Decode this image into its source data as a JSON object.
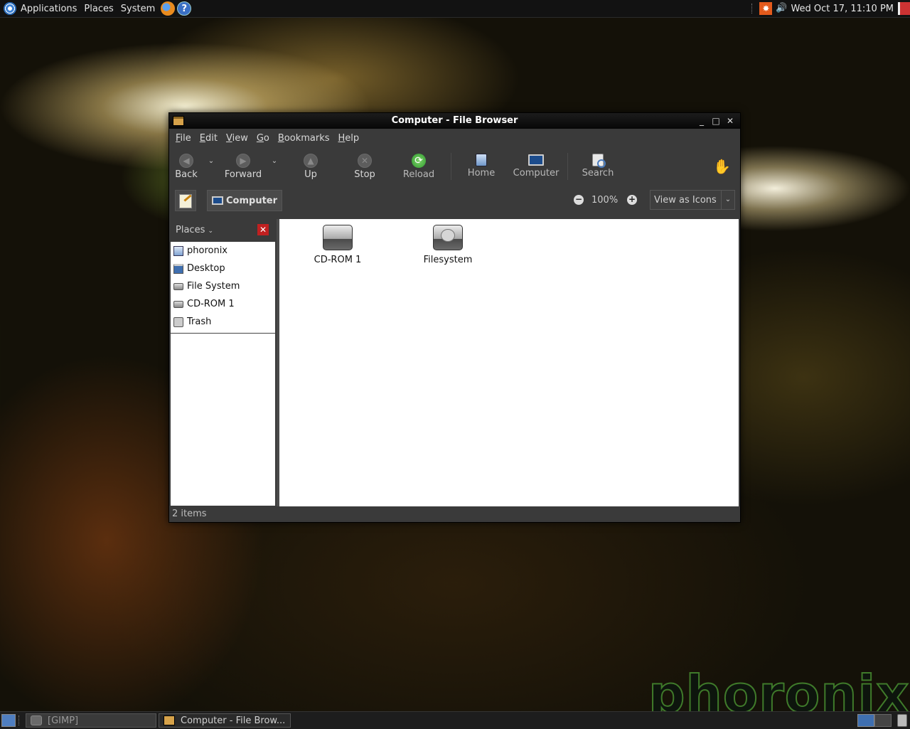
{
  "top_panel": {
    "menus": [
      "Applications",
      "Places",
      "System"
    ],
    "launchers": [
      "firefox-icon",
      "help-icon"
    ],
    "help_glyph": "?",
    "clock": "Wed Oct 17, 11:10 PM"
  },
  "window": {
    "title": "Computer - File Browser",
    "menu": [
      {
        "key": "F",
        "rest": "ile"
      },
      {
        "key": "E",
        "rest": "dit"
      },
      {
        "key": "V",
        "rest": "iew"
      },
      {
        "key": "G",
        "rest": "o"
      },
      {
        "key": "B",
        "rest": "ookmarks"
      },
      {
        "key": "H",
        "rest": "elp"
      }
    ],
    "toolbar": {
      "back": "Back",
      "forward": "Forward",
      "up": "Up",
      "stop": "Stop",
      "reload": "Reload",
      "home": "Home",
      "computer": "Computer",
      "search": "Search"
    },
    "location": {
      "crumb": "Computer",
      "zoom": "100%",
      "view_mode": "View as Icons"
    },
    "sidebar": {
      "header": "Places",
      "items": [
        "phoronix",
        "Desktop",
        "File System",
        "CD-ROM 1",
        "Trash"
      ]
    },
    "files": [
      "CD-ROM 1",
      "Filesystem"
    ],
    "status": "2 items"
  },
  "taskbar": {
    "tasks": [
      "[GIMP]",
      "Computer - File Brow..."
    ]
  },
  "watermark": "phoronix",
  "colors": {
    "panel": "#121212",
    "window_bg": "#3a3a3a",
    "content_bg": "#ffffff",
    "reload_green": "#2e9a2e",
    "sidebar_close_red": "#c02020"
  }
}
